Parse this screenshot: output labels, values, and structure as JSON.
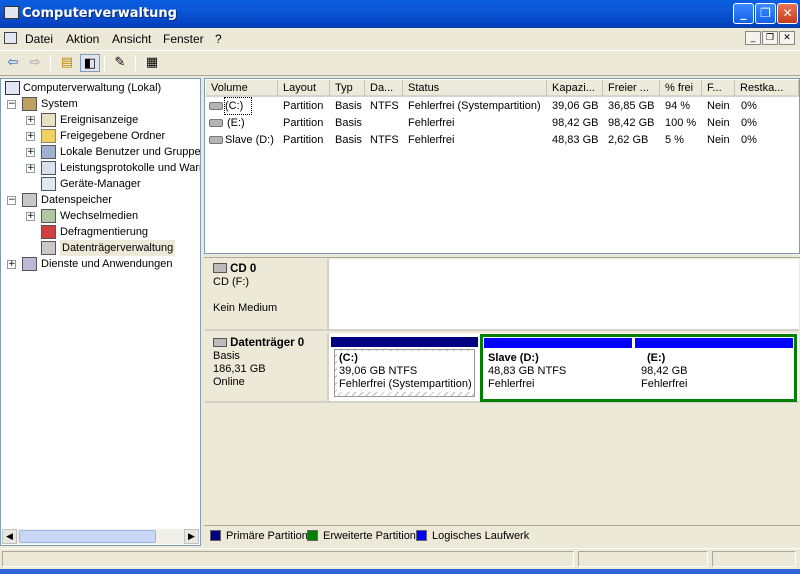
{
  "window": {
    "title": "Computerverwaltung"
  },
  "menu": [
    "Datei",
    "Aktion",
    "Ansicht",
    "Fenster",
    "?"
  ],
  "tree": {
    "root": "Computerverwaltung (Lokal)",
    "system": "System",
    "system_items": [
      "Ereignisanzeige",
      "Freigegebene Ordner",
      "Lokale Benutzer und Gruppen",
      "Leistungsprotokolle und Warnungen",
      "Geräte-Manager"
    ],
    "storage": "Datenspeicher",
    "storage_items": [
      "Wechselmedien",
      "Defragmentierung",
      "Datenträgerverwaltung"
    ],
    "services": "Dienste und Anwendungen"
  },
  "volume_list": {
    "columns": [
      "Volume",
      "Layout",
      "Typ",
      "Da...",
      "Status",
      "Kapazi...",
      "Freier ...",
      "% frei",
      "F...",
      "Restka..."
    ],
    "rows": [
      [
        "(C:)",
        "Partition",
        "Basis",
        "NTFS",
        "Fehlerfrei (Systempartition)",
        "39,06 GB",
        "36,85 GB",
        "94 %",
        "Nein",
        "0%"
      ],
      [
        "(E:)",
        "Partition",
        "Basis",
        "",
        "Fehlerfrei",
        "98,42 GB",
        "98,42 GB",
        "100 %",
        "Nein",
        "0%"
      ],
      [
        "Slave (D:)",
        "Partition",
        "Basis",
        "NTFS",
        "Fehlerfrei",
        "48,83 GB",
        "2,62 GB",
        "5 %",
        "Nein",
        "0%"
      ]
    ]
  },
  "disks": {
    "cd0": {
      "name": "CD 0",
      "drive": "CD (F:)",
      "media": "Kein Medium"
    },
    "disk0": {
      "name": "Datenträger 0",
      "type": "Basis",
      "size": "186,31 GB",
      "state": "Online",
      "partitions": [
        {
          "name": "(C:)",
          "size": "39,06 GB NTFS",
          "status": "Fehlerfrei (Systempartition)"
        },
        {
          "name": "Slave  (D:)",
          "size": "48,83 GB NTFS",
          "status": "Fehlerfrei"
        },
        {
          "name": "(E:)",
          "size": "98,42 GB",
          "status": "Fehlerfrei"
        }
      ]
    }
  },
  "legend": {
    "items": [
      {
        "label": "Primäre Partition",
        "color": "#000080"
      },
      {
        "label": "Erweiterte Partition",
        "color": "#008000"
      },
      {
        "label": "Logisches Laufwerk",
        "color": "#0000ff"
      }
    ]
  },
  "colors": {
    "titlebar": "#0a5ee0",
    "primary": "#000080",
    "extended": "#008000",
    "logical": "#0000ff"
  }
}
